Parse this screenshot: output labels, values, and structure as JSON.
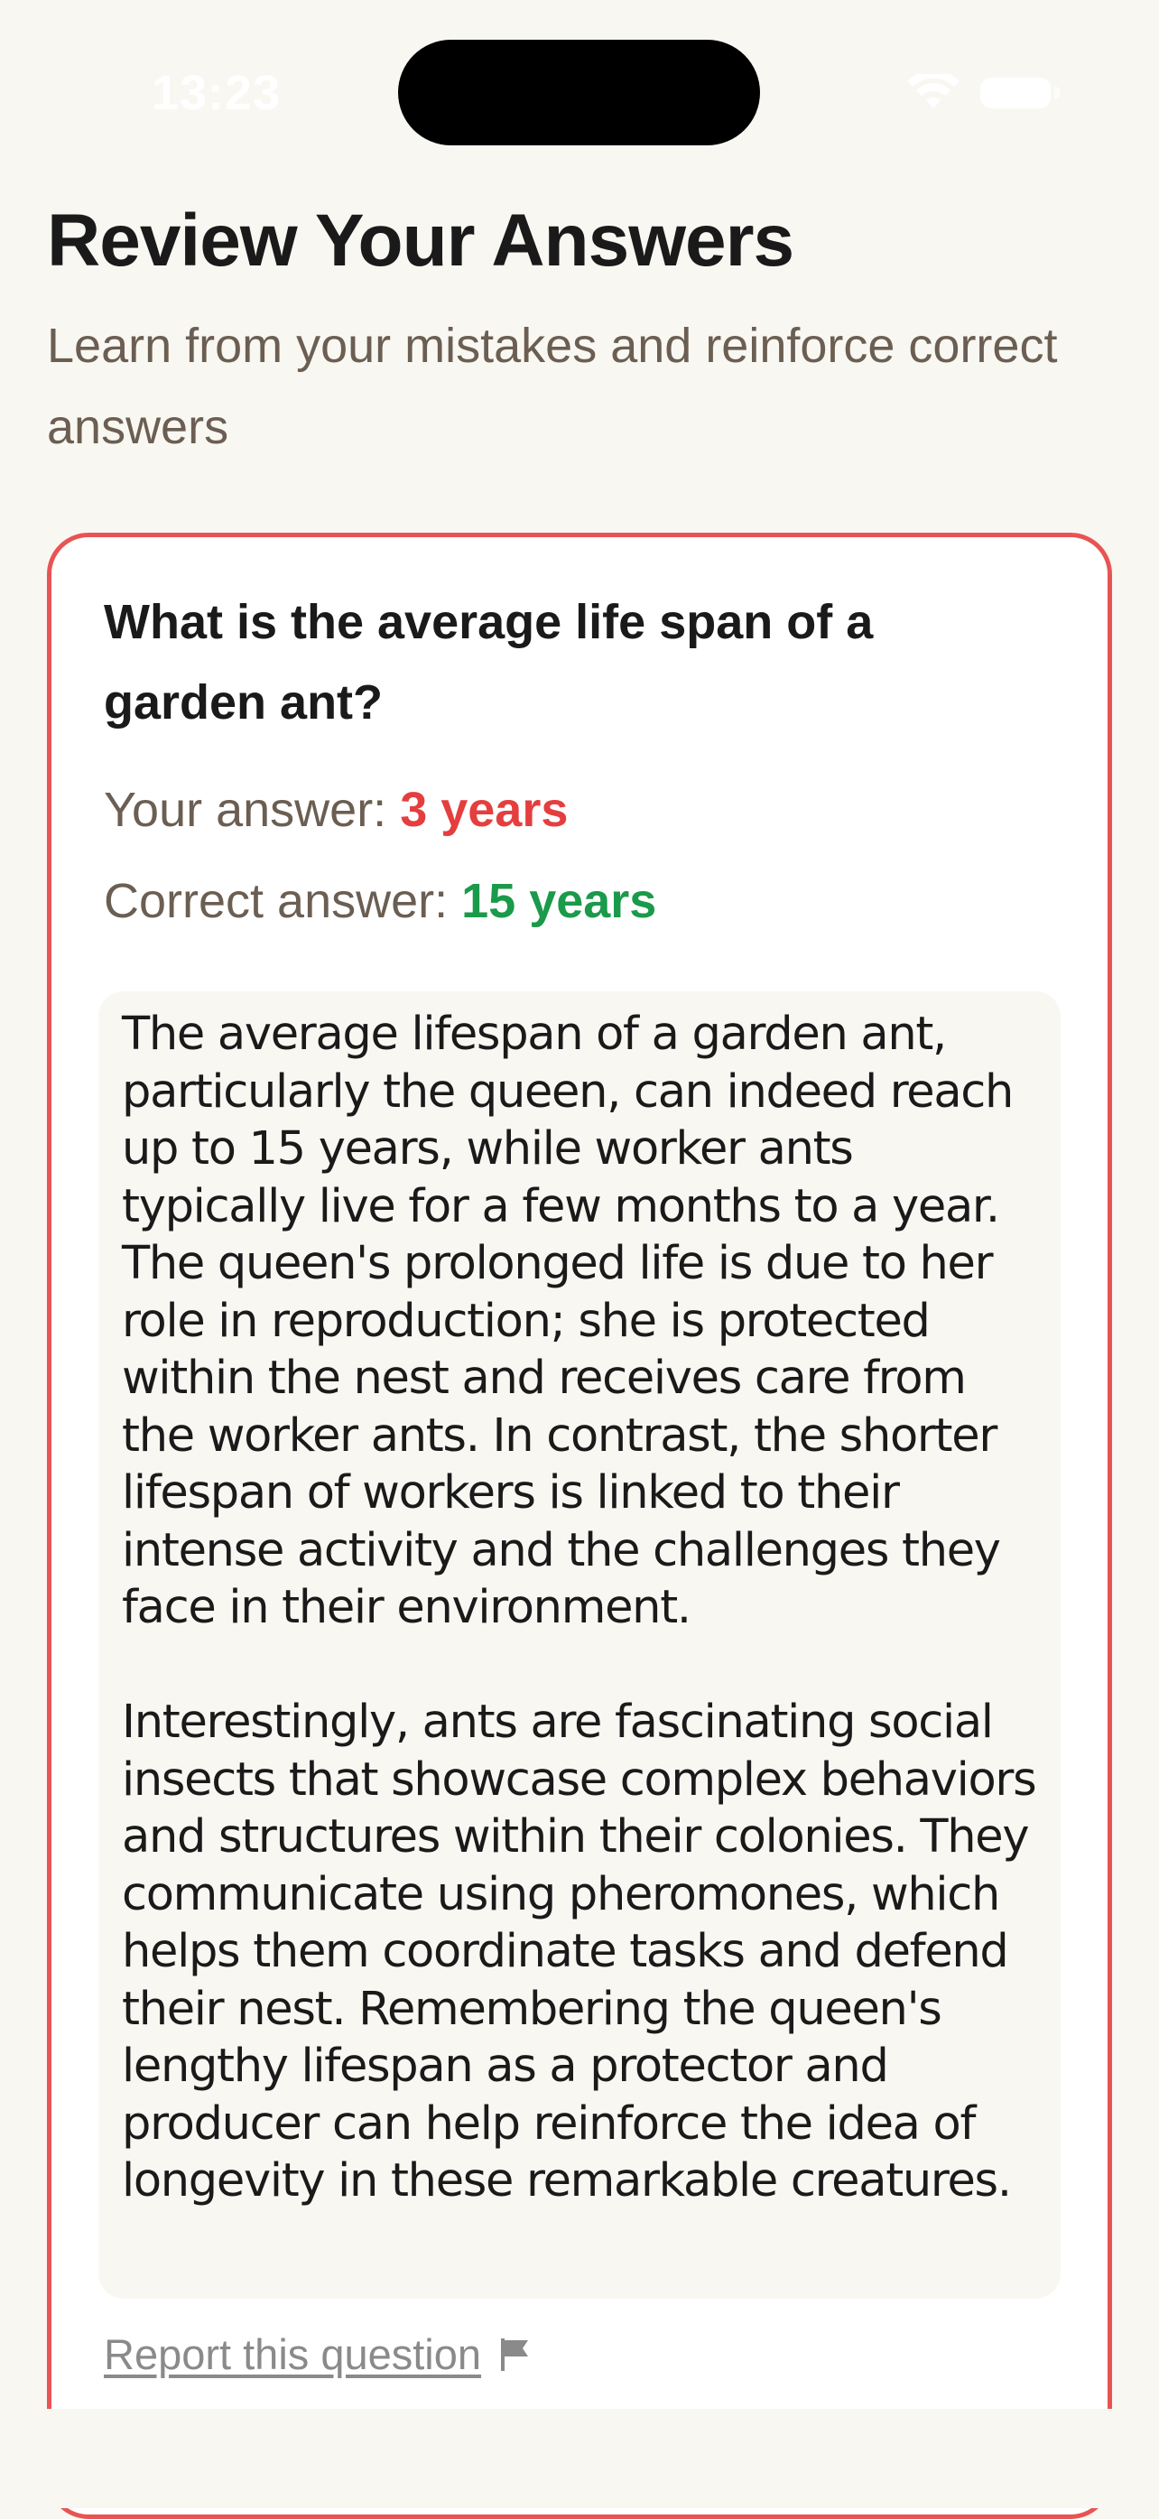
{
  "status_bar": {
    "time": "13:23"
  },
  "header": {
    "title": "Review Your Answers",
    "subtitle": "Learn from your mistakes and reinforce correct answers"
  },
  "card": {
    "question": "What is the average life span of a garden ant?",
    "your_answer_label": "Your answer: ",
    "your_answer_value": "3 years",
    "correct_answer_label": "Correct answer: ",
    "correct_answer_value": "15 years",
    "explanation_paragraphs": [
      "The average lifespan of a garden ant, particularly the queen, can indeed reach up to 15 years, while worker ants typically live for a few months to a year. The queen's prolonged life is due to her role in reproduction; she is protected within the nest and receives care from the worker ants. In contrast, the shorter lifespan of workers is linked to their intense activity and the challenges they face in their environment.",
      "Interestingly, ants are fascinating social insects that showcase complex behaviors and structures within their colonies. They communicate using pheromones, which helps them coordinate tasks and defend their nest. Remembering the queen's lengthy lifespan as a protector and producer can help reinforce the idea of longevity in these remarkable creatures."
    ],
    "report_label": "Report this question"
  },
  "colors": {
    "background": "#f9f7f2",
    "card_border": "#e85454",
    "wrong": "#e53e3e",
    "correct": "#1a9a4a",
    "muted": "#6b5e52"
  },
  "icons": {
    "report": "flag-icon",
    "wifi": "wifi-icon",
    "battery": "battery-icon"
  }
}
